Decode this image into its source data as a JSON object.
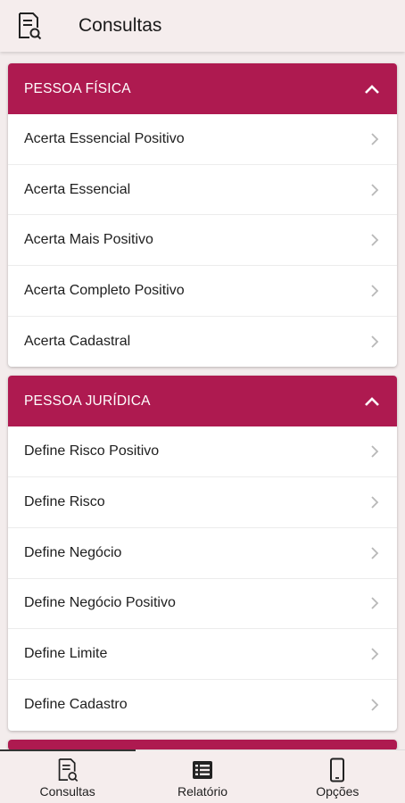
{
  "appbar": {
    "title": "Consultas",
    "icon": "document-search-icon"
  },
  "sections": [
    {
      "title": "PESSOA FÍSICA",
      "items": [
        "Acerta Essencial Positivo",
        "Acerta Essencial",
        "Acerta Mais Positivo",
        "Acerta Completo Positivo",
        "Acerta Cadastral"
      ]
    },
    {
      "title": "PESSOA JURÍDICA",
      "items": [
        "Define Risco Positivo",
        "Define Risco",
        "Define Negócio",
        "Define Negócio Positivo",
        "Define Limite",
        "Define Cadastro"
      ]
    }
  ],
  "bottom_nav": [
    {
      "label": "Consultas",
      "icon": "document-search-icon",
      "active": true
    },
    {
      "label": "Relatório",
      "icon": "list-icon",
      "active": false
    },
    {
      "label": "Opções",
      "icon": "smartphone-icon",
      "active": false
    }
  ],
  "colors": {
    "header_bg": "#ae1a50",
    "appbar_bg": "#f5eded"
  }
}
